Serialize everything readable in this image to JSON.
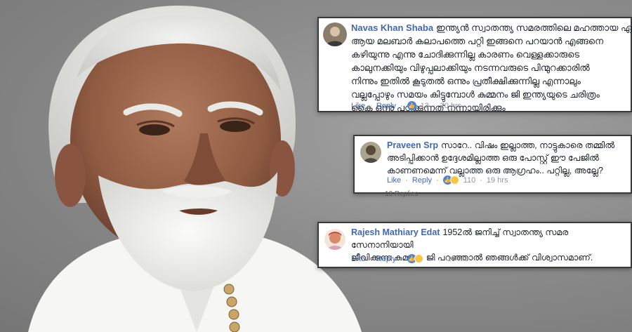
{
  "comments": [
    {
      "author": "Navas Khan Shaba",
      "text": "ഇന്ത്യൻ സ്വാതന്ത്യ സമരത്തിലെ മഹത്തായ ഏ\nആയ മലബാർ കലാപത്തെ പറ്റി ഇങ്ങനെ പറയാൻ എങ്ങനെ\nകഴിയുന്നു എന്നു ചോദിക്കുന്നില്ല കാരണം വെള്ളക്കാരുടെ\nകാലുനക്കിയും വിഴുപ്പലാക്കിയും നടന്നവരുടെ പിന്മുറക്കാരിൽ\nനിന്നും ഇതിൽ കൂടുതൽ ഒന്നും പ്രതീക്ഷിക്കുന്നില്ല എന്നാലും\nവല്ലപ്പോഴും സമയം കിട്ടുമ്പോൾ കുമ്മനം ജി ഇന്ത്യയുടെ ചരിത്രം\nകൈ ഒന്നു പഠിക്കുന്നത് നന്നായിരിക്കും",
      "like": "Like",
      "reply": "Reply",
      "reactions": "13",
      "time": "20 hrs"
    },
    {
      "author": "Praveen Srp",
      "text": "സാറേ.. വിഷം ഇല്ലാത്ത, നാട്ടുകാരെ തമ്മിൽ\nഅടിപ്പിക്കാൻ ഉദ്ദേശമില്ലാത്ത ഒരു പോസ്റ്റ് ഈ പേജിൽ\nകാണണമെന്ന് വല്ലാത്ത ഒരു ആഗ്രഹം.. പറ്റില്ല, അല്ലേ?",
      "like": "Like",
      "reply": "Reply",
      "reactions": "110",
      "time": "19 hrs",
      "replies_strip": "13 Replies"
    },
    {
      "author": "Rajesh Mathiary Edat",
      "text": "1952ൽ ജനിച്ച് സ്വാതന്ത്യ സമര സേനാനിയായി\nജീവിക്കുന്ന കുമ്മനം ജി പറഞ്ഞാൽ ഞങ്ങൾക്ക് വിശ്വാസമാണ്.",
      "like": "Like",
      "reply": "Reply",
      "reactions": "44",
      "time": "19 hrs"
    }
  ],
  "icons": {
    "like": "like-reaction-icon",
    "haha": "haha-reaction-icon"
  },
  "colors": {
    "author": "#4267b2",
    "meta": "#90949c",
    "like_reaction": "#4f80e1",
    "haha_reaction": "#f7c744"
  }
}
